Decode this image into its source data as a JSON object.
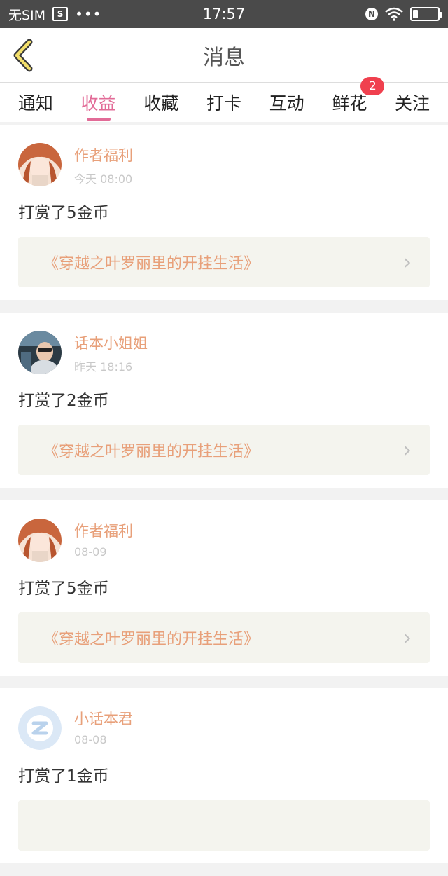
{
  "status_bar": {
    "carrier": "无SIM",
    "sim_icon": "sim-card-icon",
    "dots": "•••",
    "time": "17:57",
    "nfc": "N"
  },
  "nav": {
    "title": "消息"
  },
  "tabs": [
    {
      "label": "通知"
    },
    {
      "label": "收益",
      "active": true
    },
    {
      "label": "收藏"
    },
    {
      "label": "打卡"
    },
    {
      "label": "互动"
    },
    {
      "label": "鲜花",
      "badge": "2"
    },
    {
      "label": "关注"
    }
  ],
  "messages": [
    {
      "author": "作者福利",
      "time": "今天 08:00",
      "text": "打赏了5金币",
      "book": "《穿越之叶罗丽里的开挂生活》"
    },
    {
      "author": "话本小姐姐",
      "time": "昨天 18:16",
      "text": "打赏了2金币",
      "book": "《穿越之叶罗丽里的开挂生活》"
    },
    {
      "author": "作者福利",
      "time": "08-09",
      "text": "打赏了5金币",
      "book": "《穿越之叶罗丽里的开挂生活》"
    },
    {
      "author": "小话本君",
      "time": "08-08",
      "text": "打赏了1金币",
      "book": ""
    }
  ],
  "colors": {
    "accent": "#e26b97",
    "author": "#e8a07a",
    "badge": "#f0404e"
  }
}
